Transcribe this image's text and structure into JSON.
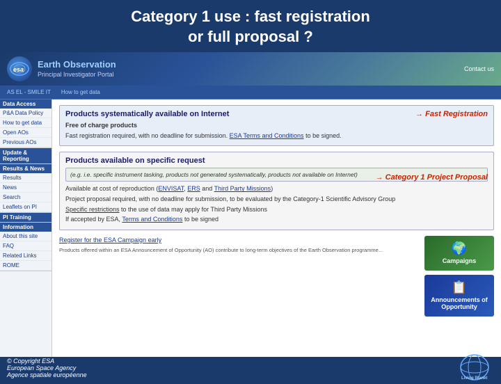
{
  "title": {
    "line1": "Category 1 use : fast registration",
    "line2": "or full proposal ?"
  },
  "header": {
    "esa_text": "esa",
    "portal_main": "Earth Observation",
    "portal_sub": "Principal Investigator Portal",
    "contact_label": "Contact us"
  },
  "nav": {
    "items": [
      "AS EL - SMILE IT"
    ]
  },
  "sidebar": {
    "sections": [
      {
        "title": "Data Access",
        "items": [
          "P&A Data Policy",
          "How to get data",
          "Open AOs",
          "Previous AOs"
        ]
      },
      {
        "title": "Update & Reporting",
        "items": []
      },
      {
        "title": "Results & News",
        "items": [
          "Results",
          "News",
          "Search",
          "Leaflets on PI"
        ]
      },
      {
        "title": "PI Training",
        "items": []
      },
      {
        "title": "Information",
        "items": [
          "About this site",
          "FAQ",
          "Related Links",
          "ROME"
        ]
      }
    ]
  },
  "products_section1": {
    "title": "Products systematically available on Internet",
    "arrow_label": "→ Fast Registration",
    "item1": "Free of charge products",
    "item2": "Fast registration required, with no deadline for submission.",
    "item2_link": "ESA Terms and Conditions",
    "item2_end": " to be signed."
  },
  "products_section2": {
    "title": "Products available on specific request",
    "italic_text": "(e.g. i.e. specific instrument tasking, products not generated systematically, products not available on Internet)",
    "arrow_label": "→ Category 1 Project Proposal",
    "items": [
      "Available at cost of reproduction (",
      "ENVISAT",
      ", ",
      "ERS",
      " and ",
      "Third Party Missions",
      ")",
      "Project proposal required, with no deadline for submission, to be evaluated by the Category-1 Scientific Advisory Group",
      "Specific restrictions to the use of data may apply for Third Party Missions",
      "If accepted by ESA, ",
      "Terms and Conditions",
      " to be signed"
    ]
  },
  "bottom_link": "Register for the ESA Campaign early",
  "bottom_buttons": {
    "campaigns": "Campaigns",
    "ao": "Announcements of Opportunity"
  },
  "bottom_text": {
    "small_text": "Products offered within an ESA Announcement of Opportunity (AO) contribute to long-term objectives of the Earth Observation programme...",
    "copyright": "© Copyright ESA",
    "agency_line1": "European Space Agency",
    "agency_line2": "Agence spatiale européenne"
  },
  "living_planet": "Living Planet"
}
